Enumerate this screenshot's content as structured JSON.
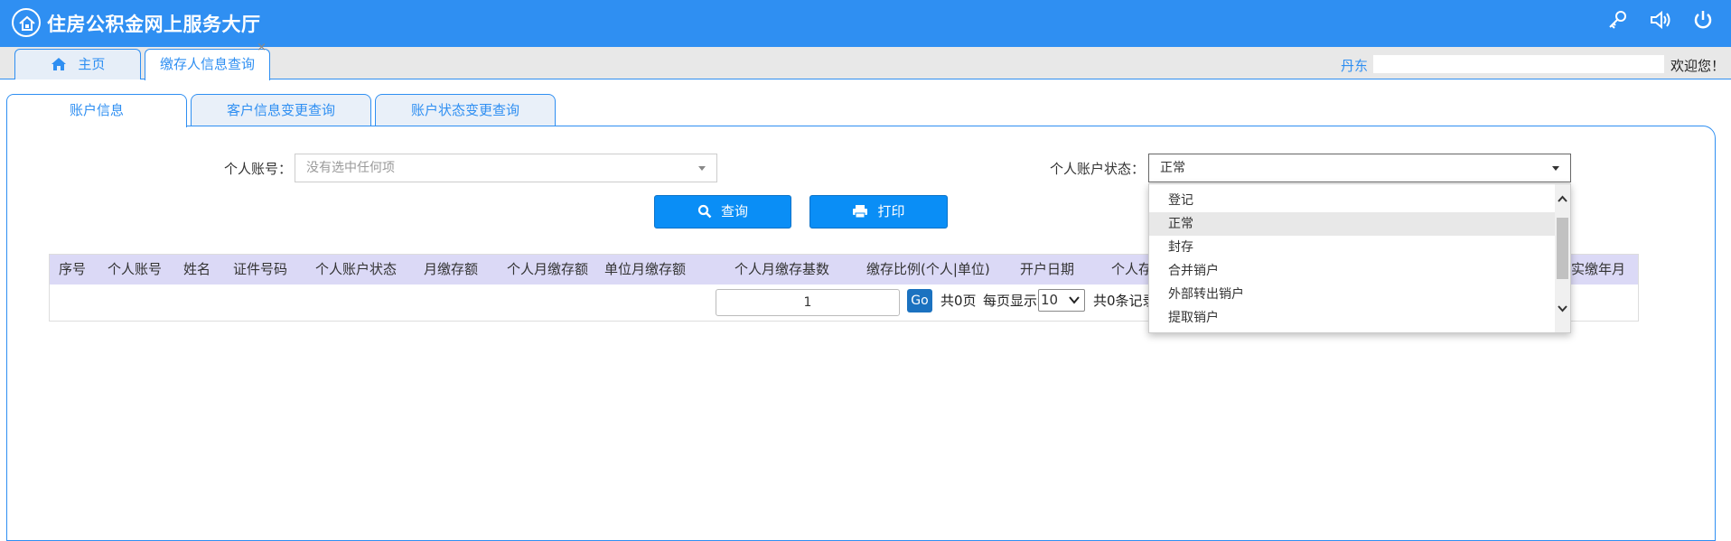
{
  "header": {
    "title": "住房公积金网上服务大厅",
    "icons": [
      "key-icon",
      "volume-icon",
      "power-icon"
    ]
  },
  "top_tabs": [
    {
      "label": "主页"
    },
    {
      "label": "缴存人信息查询",
      "close": "×"
    }
  ],
  "user_bar": {
    "region": "丹东",
    "welcome": "欢迎您！"
  },
  "sub_tabs": [
    {
      "label": "账户信息"
    },
    {
      "label": "客户信息变更查询"
    },
    {
      "label": "账户状态变更查询"
    }
  ],
  "filters": {
    "account_label": "个人账号：",
    "account_placeholder": "没有选中任何项",
    "status_label": "个人账户状态：",
    "status_value": "正常"
  },
  "buttons": {
    "query": "查询",
    "print": "打印"
  },
  "table": {
    "columns": [
      "序号",
      "个人账号",
      "姓名",
      "证件号码",
      "个人账户状态",
      "月缴存额",
      "个人月缴存额",
      "单位月缴存额",
      "个人月缴存基数",
      "缴存比例(个人|单位)",
      "开户日期",
      "个人存",
      "实缴年月"
    ]
  },
  "pager": {
    "page_value": "1",
    "go": "Go",
    "total_pages": "共0页",
    "per_page_label": "每页显示",
    "page_size": "10",
    "total_records": "共0条记录"
  },
  "status_dropdown": {
    "options": [
      "登记",
      "正常",
      "封存",
      "合并销户",
      "外部转出销户",
      "提取销户"
    ],
    "hovered": "正常"
  },
  "colors": {
    "primary": "#2f8ff2",
    "button": "#0a8ef6",
    "table_header": "#dbd9f6"
  }
}
